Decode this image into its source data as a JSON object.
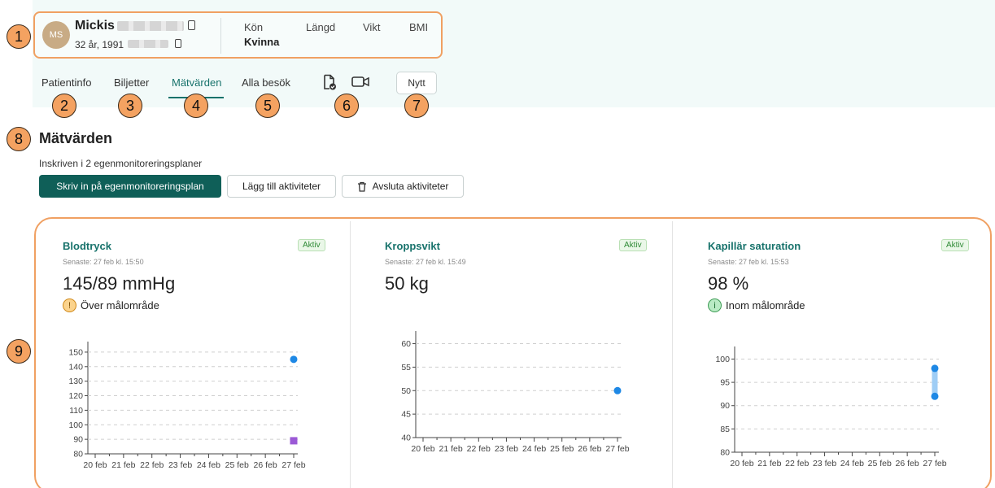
{
  "patient": {
    "initials": "MS",
    "name": "Mickis",
    "age_line": "32 år, 1991",
    "attributes": [
      {
        "label": "Kön",
        "value": "Kvinna"
      },
      {
        "label": "Längd",
        "value": ""
      },
      {
        "label": "Vikt",
        "value": ""
      },
      {
        "label": "BMI",
        "value": ""
      }
    ]
  },
  "tabs": [
    {
      "label": "Patientinfo"
    },
    {
      "label": "Biljetter"
    },
    {
      "label": "Mätvärden",
      "active": true
    },
    {
      "label": "Alla besök"
    }
  ],
  "toolbar": {
    "new_label": "Nytt",
    "icons": [
      "document-check-icon",
      "video-call-icon"
    ]
  },
  "callouts": [
    "1",
    "2",
    "3",
    "4",
    "5",
    "6",
    "7",
    "8",
    "9"
  ],
  "section": {
    "title": "Mätvärden",
    "subtitle": "Inskriven i 2 egenmonitoreringsplaner",
    "buttons": {
      "enroll": "Skriv in på egenmonitoreringsplan",
      "add": "Lägg till aktiviteter",
      "end": "Avsluta aktiviteter"
    }
  },
  "cards": [
    {
      "title": "Blodtryck",
      "latest": "Senaste: 27 feb kl. 15:50",
      "badge": "Aktiv",
      "value": "145/89 mmHg",
      "status": "Över målområde",
      "status_icon": "!",
      "status_type": "warn"
    },
    {
      "title": "Kroppsvikt",
      "latest": "Senaste: 27 feb kl. 15:49",
      "badge": "Aktiv",
      "value": "50 kg"
    },
    {
      "title": "Kapillär saturation",
      "latest": "Senaste: 27 feb kl. 15:53",
      "badge": "Aktiv",
      "value": "98 %",
      "status": "Inom målområde",
      "status_icon": "i",
      "status_type": "ok"
    }
  ],
  "colors": {
    "primary": "#0f5f58",
    "accent": "#17726b",
    "callout": "#f4a261",
    "highlight": "#f0a062",
    "series_blue": "#1e88e5",
    "series_purple": "#9b59d6"
  },
  "chart_data": [
    {
      "type": "scatter",
      "categories": [
        "20 feb",
        "21 feb",
        "22 feb",
        "23 feb",
        "24 feb",
        "25 feb",
        "26 feb",
        "27 feb"
      ],
      "yticks": [
        80,
        90,
        100,
        110,
        120,
        130,
        140,
        150
      ],
      "ylim": [
        80,
        155
      ],
      "grid": true,
      "series": [
        {
          "values": [
            null,
            null,
            null,
            null,
            null,
            null,
            null,
            145
          ],
          "color": "#1e88e5",
          "marker": "circle"
        },
        {
          "values": [
            null,
            null,
            null,
            null,
            null,
            null,
            null,
            89
          ],
          "color": "#9b59d6",
          "marker": "square"
        }
      ]
    },
    {
      "type": "scatter",
      "categories": [
        "20 feb",
        "21 feb",
        "22 feb",
        "23 feb",
        "24 feb",
        "25 feb",
        "26 feb",
        "27 feb"
      ],
      "yticks": [
        40,
        45,
        50,
        55,
        60
      ],
      "ylim": [
        40,
        62
      ],
      "grid": true,
      "series": [
        {
          "values": [
            null,
            null,
            null,
            null,
            null,
            null,
            null,
            50
          ],
          "color": "#1e88e5",
          "marker": "circle"
        }
      ]
    },
    {
      "type": "scatter",
      "categories": [
        "20 feb",
        "21 feb",
        "22 feb",
        "23 feb",
        "24 feb",
        "25 feb",
        "26 feb",
        "27 feb"
      ],
      "yticks": [
        80,
        85,
        90,
        95,
        100
      ],
      "ylim": [
        80,
        102
      ],
      "grid": true,
      "range": {
        "category": "27 feb",
        "low": 92,
        "high": 98
      },
      "series": [
        {
          "values": [
            null,
            null,
            null,
            null,
            null,
            null,
            null,
            98
          ],
          "color": "#1e88e5",
          "marker": "circle"
        },
        {
          "values": [
            null,
            null,
            null,
            null,
            null,
            null,
            null,
            92
          ],
          "color": "#1e88e5",
          "marker": "circle"
        }
      ]
    }
  ]
}
